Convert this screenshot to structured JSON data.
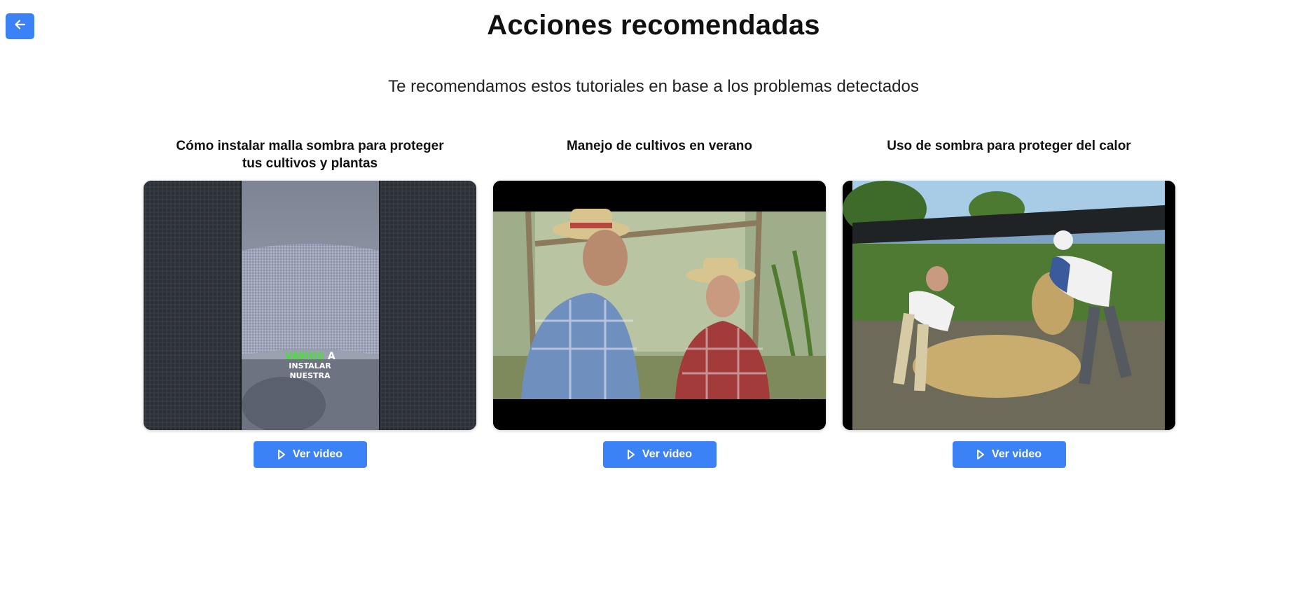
{
  "header": {
    "back_icon": "arrow-left-icon",
    "title": "Acciones recomendadas",
    "subtitle": "Te recomendamos estos tutoriales en base a los problemas detectados"
  },
  "cards": [
    {
      "title": "Cómo instalar malla sombra para proteger tus cultivos y plantas",
      "overlay_highlight": "VAMOS",
      "overlay_rest": " A",
      "overlay_line2": "INSTALAR",
      "overlay_line3": "NUESTRA",
      "button_label": "Ver video",
      "button_icon": "play-icon"
    },
    {
      "title": "Manejo de cultivos en verano",
      "button_label": "Ver video",
      "button_icon": "play-icon"
    },
    {
      "title": "Uso de sombra para proteger del calor",
      "button_label": "Ver video",
      "button_icon": "play-icon"
    }
  ],
  "colors": {
    "accent": "#3b82f6",
    "overlay_highlight": "#4ade3a"
  }
}
